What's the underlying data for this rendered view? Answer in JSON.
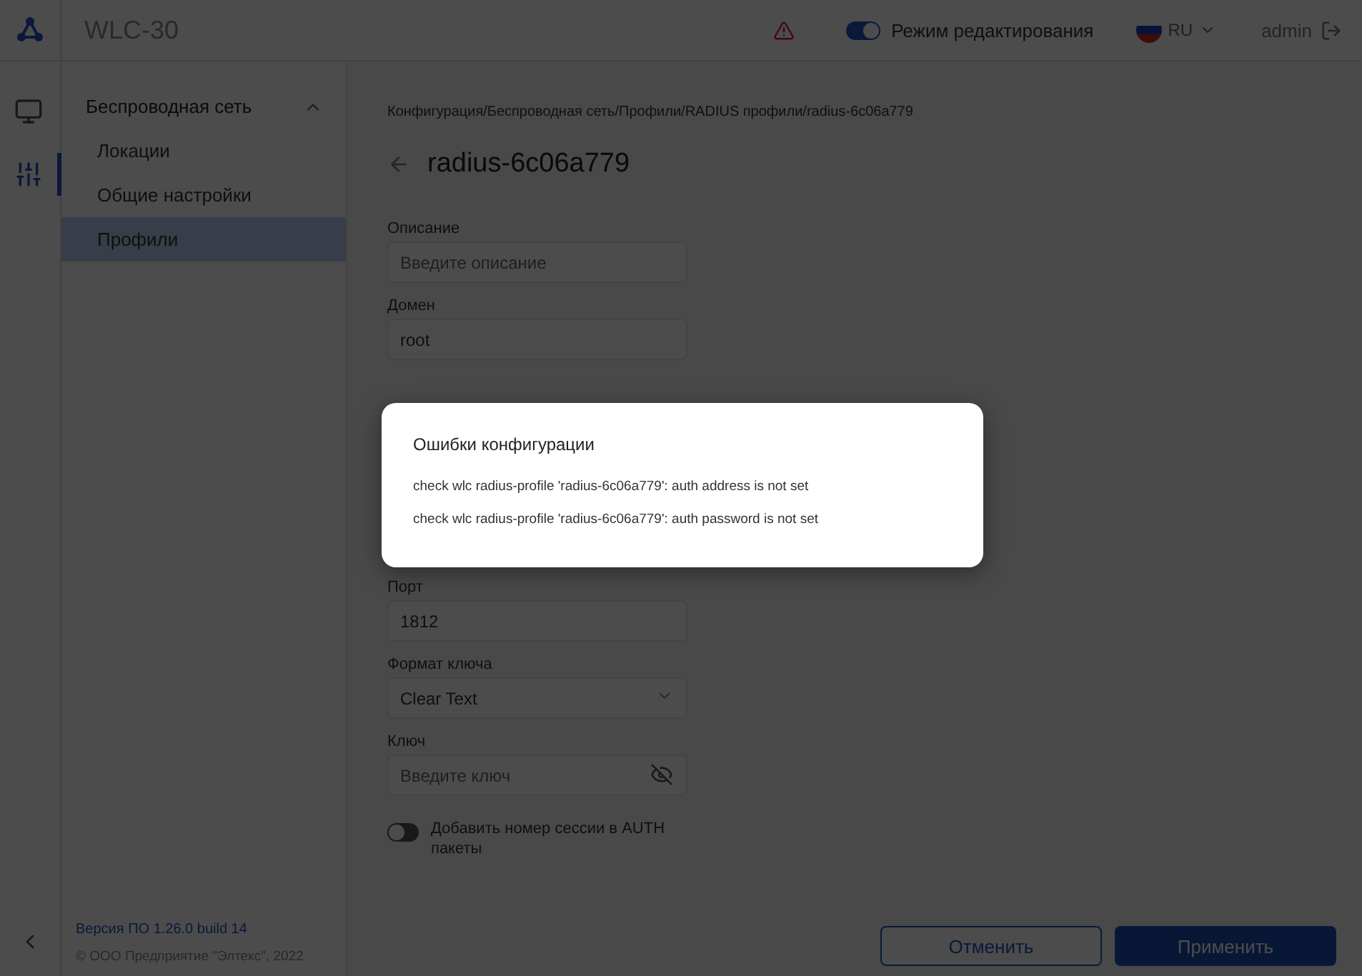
{
  "header": {
    "title": "WLC-30",
    "edit_mode": {
      "label": "Режим редактирования",
      "on": true
    },
    "language": "RU",
    "user": "admin"
  },
  "rail": {
    "items": [
      {
        "kind": "monitor",
        "selected": false
      },
      {
        "kind": "sliders",
        "selected": true
      }
    ]
  },
  "sidebar": {
    "section": {
      "title": "Беспроводная сеть",
      "expanded": true
    },
    "items": [
      {
        "label": "Локации",
        "selected": false
      },
      {
        "label": "Общие настройки",
        "selected": false
      },
      {
        "label": "Профили",
        "selected": true
      }
    ],
    "version": "Версия ПО 1.26.0 build 14",
    "copyright": "© ООО Предприятие \"Элтекс\", 2022"
  },
  "main": {
    "breadcrumb": "Конфигурация/Беспроводная сеть/Профили/RADIUS профили/radius-6c06a779",
    "title": "radius-6c06a779",
    "fields_top": [
      {
        "kind": "text",
        "label": "Описание",
        "placeholder": "Введите описание"
      },
      {
        "kind": "text",
        "label": "Домен",
        "value": "root"
      }
    ],
    "fields_bottom": [
      {
        "kind": "text",
        "label": "Порт",
        "value": "1812"
      },
      {
        "kind": "select",
        "label": "Формат ключа",
        "value": "Clear Text"
      },
      {
        "kind": "password",
        "label": "Ключ",
        "placeholder": "Введите ключ"
      }
    ],
    "toggle": {
      "label": "Добавить номер сессии в AUTH пакеты",
      "on": false
    },
    "buttons": [
      {
        "label": "Отменить",
        "kind": "secondary"
      },
      {
        "label": "Применить",
        "kind": "primary"
      }
    ]
  },
  "dialog": {
    "title": "Ошибки конфигурации",
    "messages": [
      "check wlc radius-profile 'radius-6c06a779': auth address is not set",
      "check wlc radius-profile 'radius-6c06a779': auth password is not set"
    ]
  }
}
